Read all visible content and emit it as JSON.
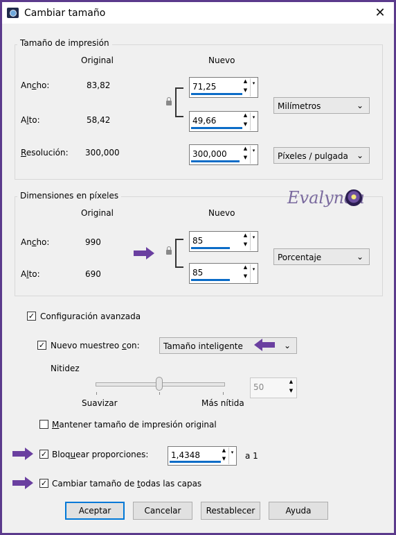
{
  "window": {
    "title": "Cambiar tamaño",
    "close_label": "✕"
  },
  "print_size": {
    "group_title": "Tamaño de impresión",
    "col_original": "Original",
    "col_new": "Nuevo",
    "width_label_pre": "An",
    "width_label_ul": "c",
    "width_label_post": "ho:",
    "width_original": "83,82",
    "width_new": "71,25",
    "height_label_pre": "A",
    "height_label_ul": "l",
    "height_label_post": "to:",
    "height_original": "58,42",
    "height_new": "49,66",
    "resolution_label_ul": "R",
    "resolution_label_post": "esolución:",
    "resolution_original": "300,000",
    "resolution_new": "300,000",
    "unit": "Milímetros",
    "resolution_unit": "Píxeles / pulgada"
  },
  "pixel_dims": {
    "group_title": "Dimensiones en píxeles",
    "col_original": "Original",
    "col_new": "Nuevo",
    "width_label_pre": "An",
    "width_label_ul": "c",
    "width_label_post": "ho:",
    "width_original": "990",
    "width_new": "85",
    "height_label_pre": "A",
    "height_label_ul": "l",
    "height_label_post": "to:",
    "height_original": "690",
    "height_new": "85",
    "unit": "Porcentaje"
  },
  "watermark_text": "Evalynda",
  "advanced": {
    "checkbox_label": "Configuración avanzada",
    "checked": true
  },
  "resample": {
    "label_pre": "Nuevo muestreo ",
    "label_ul": "c",
    "label_post": "on:",
    "checked": true,
    "method": "Tamaño inteligente"
  },
  "sharpness": {
    "label": "Nitidez",
    "min_label": "Suavizar",
    "max_label": "Más nítida",
    "value": "50"
  },
  "keep_print_size": {
    "label_ul": "M",
    "label_post": "antener tamaño de impresión original",
    "checked": false
  },
  "lock_ratio": {
    "label_pre": "Bloq",
    "label_ul": "u",
    "label_post": "ear proporciones:",
    "checked": true,
    "value": "1,4348",
    "suffix": "a 1"
  },
  "all_layers": {
    "label_pre": "Cambiar tamaño de ",
    "label_ul": "t",
    "label_post": "odas las capas",
    "checked": true
  },
  "buttons": {
    "ok": "Aceptar",
    "cancel": "Cancelar",
    "reset": "Restablecer",
    "help": "Ayuda"
  },
  "colors": {
    "frame": "#5b3a8c",
    "arrow": "#6a3fa0",
    "accent": "#0078d7"
  }
}
